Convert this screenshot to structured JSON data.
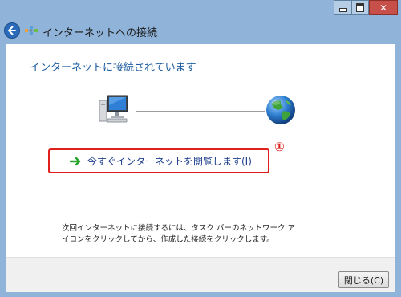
{
  "window": {
    "title": "インターネットへの接続",
    "controls": {
      "minimize": "minimize-icon",
      "maximize": "maximize-icon",
      "close": "close-icon",
      "close_color": "#c7504a"
    }
  },
  "main": {
    "heading": "インターネットに接続されています",
    "status_icons": [
      "computer-icon",
      "globe-icon"
    ],
    "browse_link": {
      "label": "今すぐインターネットを閲覧します(I)",
      "icon": "green-arrow-icon",
      "highlight_color": "#e0201c"
    },
    "annotation": "①",
    "note": "次回インターネットに接続するには、タスク バーのネットワーク アイコンをクリックしてから、作成した接続をクリックします。"
  },
  "footer": {
    "close_button": "閉じる(C)"
  }
}
